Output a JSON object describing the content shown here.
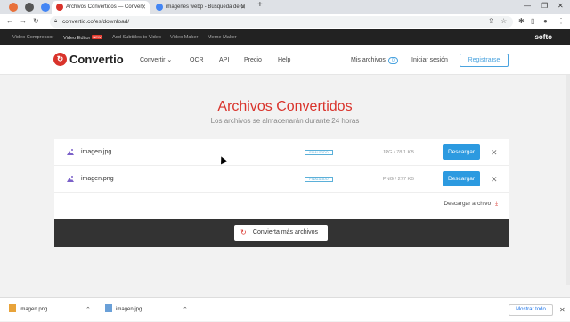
{
  "browser": {
    "tabs": [
      {
        "label": "Archivos Convertidos — Convert",
        "active": true,
        "favicon_color": "#d9332b"
      },
      {
        "label": "imagenes webp - Búsqueda de G",
        "active": false,
        "favicon_color": "#4285f4"
      }
    ],
    "url": "convertio.co/es/download/",
    "new_tab_icon": "plus-icon"
  },
  "top_bar": {
    "items": [
      "Video Compressor",
      "Video Editor",
      "Add Subtitles to Video",
      "Video Maker",
      "Meme Maker"
    ],
    "new_badge": "NEW",
    "brand": "softo"
  },
  "header": {
    "logo_text": "Convertio",
    "nav": [
      "Convertir",
      "OCR",
      "API",
      "Precio",
      "Help"
    ],
    "my_files": "Mis archivos",
    "my_files_count": "0",
    "login": "Iniciar sesión",
    "register": "Registrarse"
  },
  "main": {
    "title": "Archivos Convertidos",
    "subtitle": "Los archivos se almacenarán durante 24 horas",
    "files": [
      {
        "name": "imagen.jpg",
        "status": "FINALIZADO",
        "size": "JPG / 78.1 KB",
        "download": "Descargar"
      },
      {
        "name": "imagen.png",
        "status": "FINALIZADO",
        "size": "PNG / 277 KB",
        "download": "Descargar"
      }
    ],
    "download_file": "Descargar archivo",
    "convert_more": "Convierta más archivos"
  },
  "downloads_bar": {
    "items": [
      "imagen.png",
      "imagen.jpg"
    ],
    "show_all": "Mostrar todo"
  },
  "colors": {
    "accent_red": "#d9332b",
    "button_blue": "#2c9ae0"
  }
}
